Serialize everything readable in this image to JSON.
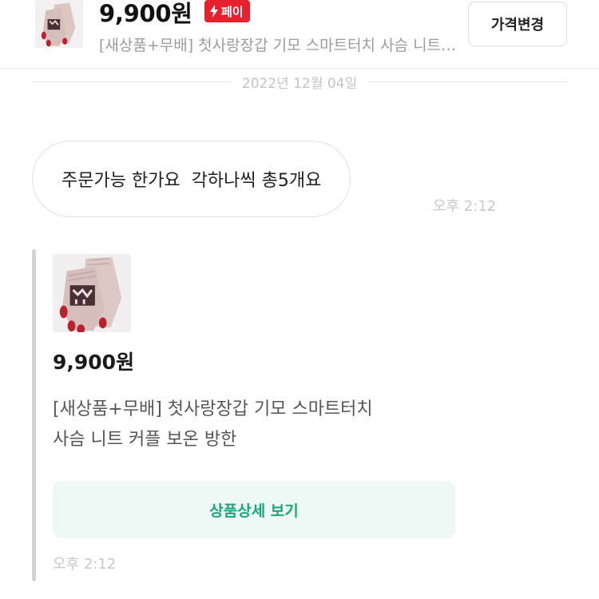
{
  "header": {
    "price": "9,900원",
    "pay_badge": "페이",
    "title": "[새상품+무배] 첫사랑장갑 기모 스마트터치 사슴 니트 커플 보온 방한",
    "price_change_button": "가격변경"
  },
  "date_separator": "2022년 12월 04일",
  "message": {
    "text": "주문가능 한가요  각하나씩 총5개요",
    "time": "오후 2:12"
  },
  "product_card": {
    "price": "9,900원",
    "title_line1": "[새상품+무배] 첫사랑장갑 기모 스마트터치",
    "title_line2": "사슴 니트 커플 보온 방한",
    "detail_button": "상품상세 보기",
    "time": "오후 2:12"
  },
  "colors": {
    "pay_red": "#e8202e",
    "detail_green": "#1aa77a",
    "detail_bg": "#eef8f4",
    "glove_pink": "#d9c3bf",
    "fingertip_red": "#b8232f"
  },
  "icons": {
    "pay": "lightning-icon",
    "product": "gloves-product-image"
  }
}
